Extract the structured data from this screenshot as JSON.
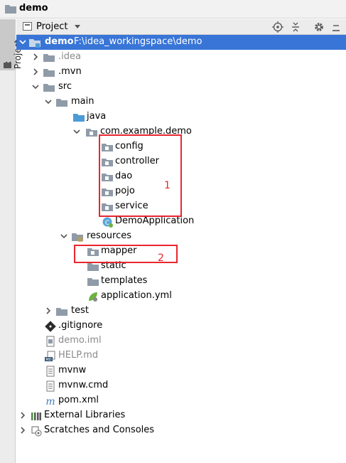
{
  "window": {
    "title": "demo"
  },
  "side_tab": {
    "label": "1: Project"
  },
  "header": {
    "view_label": "Project"
  },
  "tree": {
    "root": {
      "name": "demo",
      "path": "F:\\idea_workingspace\\demo"
    },
    "idea": ".idea",
    "mvn": ".mvn",
    "src": "src",
    "main": "main",
    "java": "java",
    "package": "com.example.demo",
    "config": "config",
    "controller": "controller",
    "dao": "dao",
    "pojo": "pojo",
    "service": "service",
    "demo_app": "DemoApplication",
    "resources": "resources",
    "mapper": "mapper",
    "static": "static",
    "templates": "templates",
    "app_yml": "application.yml",
    "test": "test",
    "gitignore": ".gitignore",
    "demo_iml": "demo.iml",
    "help_md": "HELP.md",
    "mvnw": "mvnw",
    "mvnw_cmd": "mvnw.cmd",
    "pom": "pom.xml",
    "ext_libs": "External Libraries",
    "scratches": "Scratches and Consoles"
  },
  "annotations": {
    "box1": "1",
    "box2": "2",
    "color": "#e8262e"
  },
  "colors": {
    "selection": "#3875d7",
    "folder": "#8f9ba8",
    "java_folder": "#4b9bd6",
    "resources_folder": "#c8a13c"
  }
}
